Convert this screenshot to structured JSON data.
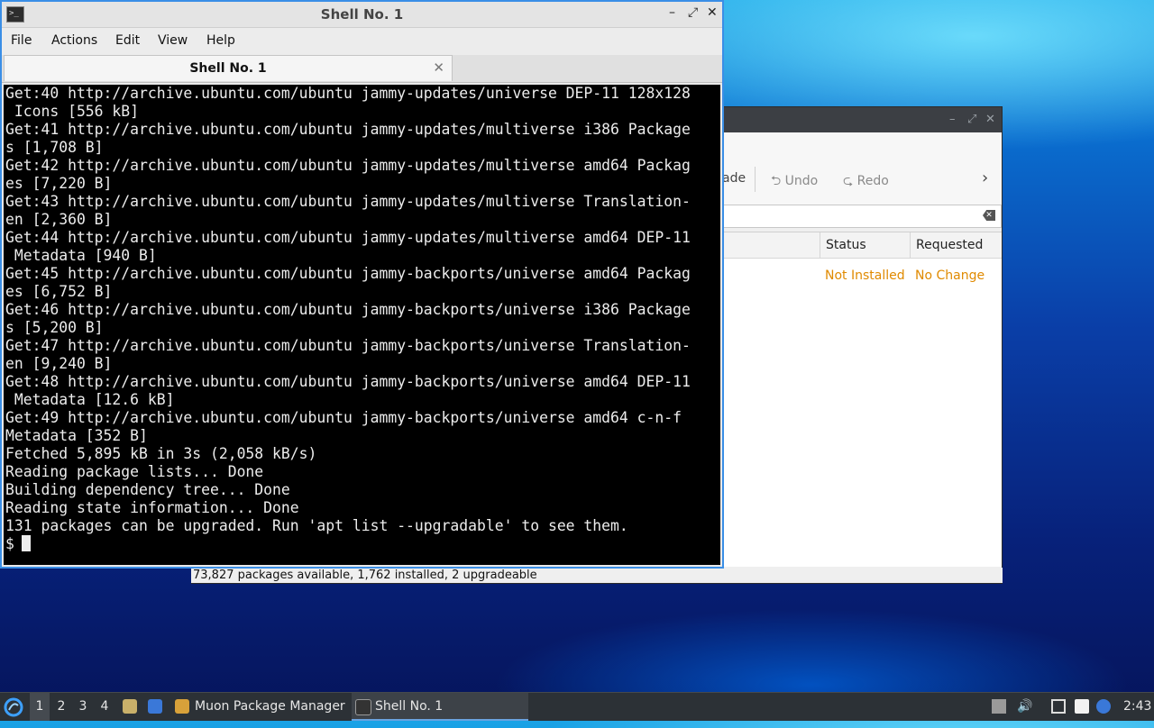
{
  "colors": {
    "accent": "#3a8ee6",
    "status_orange": "#e08a00",
    "terminal_bg": "#000000"
  },
  "muon": {
    "toolbar": {
      "partial_label": "ade",
      "undo_label": "Undo",
      "redo_label": "Redo",
      "next_icon": "chevron-right-icon"
    },
    "columns": {
      "status": "Status",
      "requested": "Requested"
    },
    "row": {
      "status": "Not Installed",
      "requested": "No Change"
    },
    "statusbar": "73,827 packages available, 1,762 installed, 2 upgradeable"
  },
  "terminal": {
    "title": "Shell No. 1",
    "menu": [
      "File",
      "Actions",
      "Edit",
      "View",
      "Help"
    ],
    "tab_label": "Shell No. 1",
    "lines": [
      "Get:40 http://archive.ubuntu.com/ubuntu jammy-updates/universe DEP-11 128x128",
      " Icons [556 kB]",
      "Get:41 http://archive.ubuntu.com/ubuntu jammy-updates/multiverse i386 Package",
      "s [1,708 B]",
      "Get:42 http://archive.ubuntu.com/ubuntu jammy-updates/multiverse amd64 Packag",
      "es [7,220 B]",
      "Get:43 http://archive.ubuntu.com/ubuntu jammy-updates/multiverse Translation-",
      "en [2,360 B]",
      "Get:44 http://archive.ubuntu.com/ubuntu jammy-updates/multiverse amd64 DEP-11",
      " Metadata [940 B]",
      "Get:45 http://archive.ubuntu.com/ubuntu jammy-backports/universe amd64 Packag",
      "es [6,752 B]",
      "Get:46 http://archive.ubuntu.com/ubuntu jammy-backports/universe i386 Package",
      "s [5,200 B]",
      "Get:47 http://archive.ubuntu.com/ubuntu jammy-backports/universe Translation-",
      "en [9,240 B]",
      "Get:48 http://archive.ubuntu.com/ubuntu jammy-backports/universe amd64 DEP-11",
      " Metadata [12.6 kB]",
      "Get:49 http://archive.ubuntu.com/ubuntu jammy-backports/universe amd64 c-n-f",
      "Metadata [352 B]",
      "Fetched 5,895 kB in 3s (2,058 kB/s)",
      "Reading package lists... Done",
      "Building dependency tree... Done",
      "Reading state information... Done",
      "131 packages can be upgraded. Run 'apt list --upgradable' to see them."
    ],
    "prompt": "$"
  },
  "taskbar": {
    "workspaces": [
      "1",
      "2",
      "3",
      "4"
    ],
    "tasks": [
      {
        "label": "Muon Package Manager",
        "icon": "package-manager-icon"
      },
      {
        "label": "Shell No. 1",
        "icon": "terminal-icon"
      }
    ],
    "clock": "2:43"
  }
}
